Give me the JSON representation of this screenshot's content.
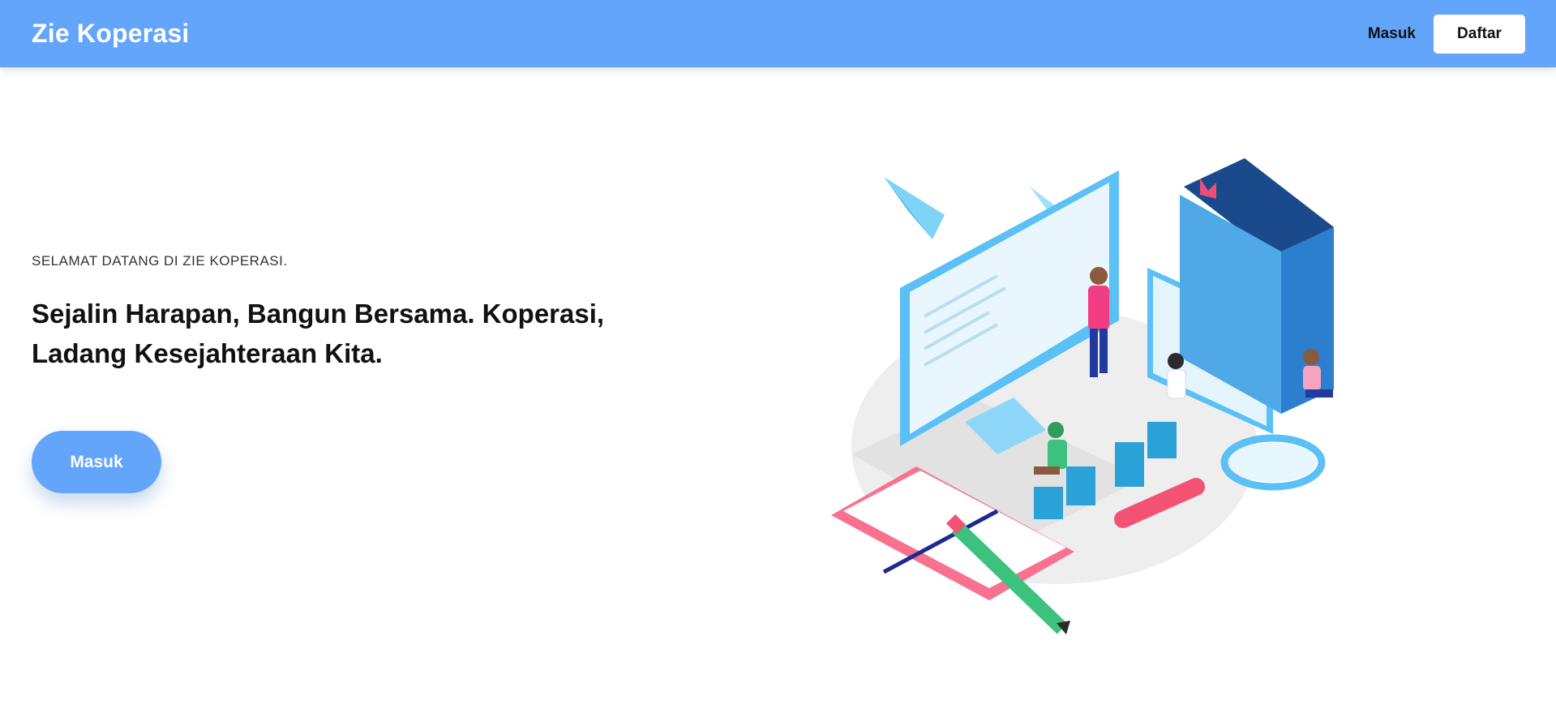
{
  "navbar": {
    "brand": "Zie Koperasi",
    "login_link": "Masuk",
    "register_button": "Daftar",
    "background_color": "#62a5fb"
  },
  "hero": {
    "eyebrow": "SELAMAT DATANG DI ZIE KOPERASI.",
    "headline_line1": "Sejalin Harapan, Bangun Bersama. Koperasi,",
    "headline_line2": "Ladang Kesejahteraan Kita.",
    "cta_label": "Masuk"
  },
  "colors": {
    "accent": "#62a5fb",
    "text_dark": "#111111"
  },
  "illustration": {
    "icon": "isometric-learning-illustration"
  }
}
